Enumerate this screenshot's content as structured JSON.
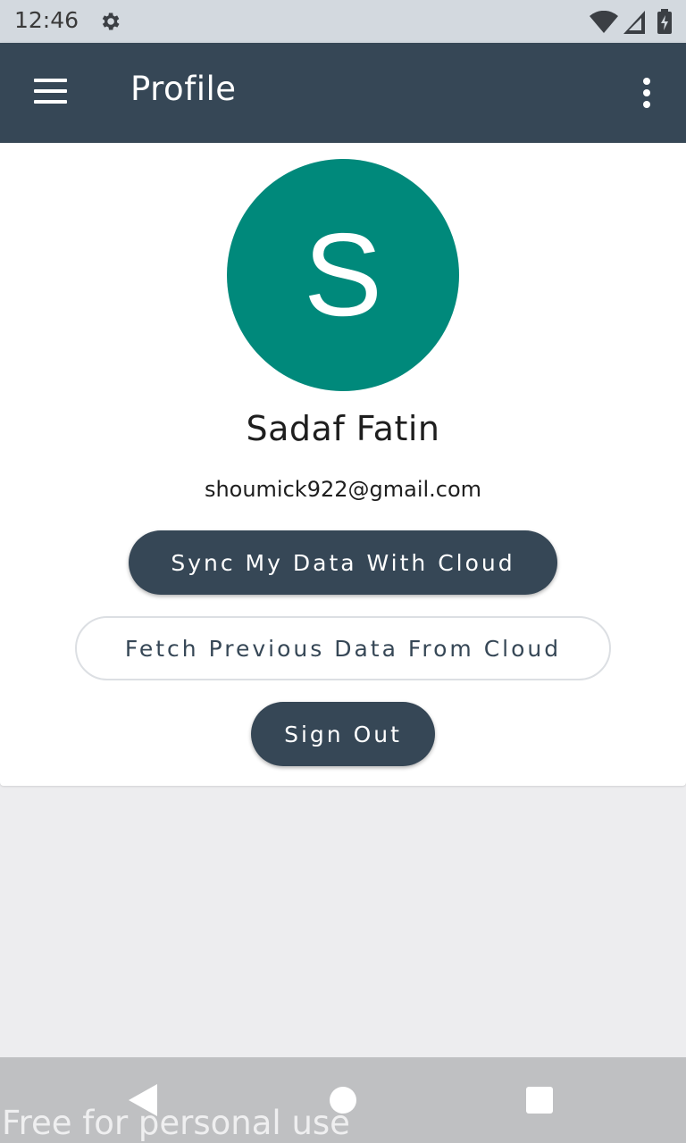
{
  "status_bar": {
    "time": "12:46",
    "icons": [
      "gear-icon",
      "wifi-icon",
      "signal-icon",
      "battery-charging-icon"
    ]
  },
  "app_bar": {
    "title": "Profile",
    "background_color": "#364756",
    "icons": [
      "hamburger-menu-icon",
      "more-vert-icon"
    ]
  },
  "profile": {
    "avatar_initial": "S",
    "avatar_color": "#00897b",
    "name": "Sadaf Fatin",
    "email": "shoumick922@gmail.com"
  },
  "actions": {
    "sync_label": "Sync My Data With Cloud",
    "fetch_label": "Fetch Previous Data From Cloud",
    "sign_out_label": "Sign Out"
  },
  "nav_bar": {
    "icons": [
      "back-icon",
      "home-icon",
      "recents-icon"
    ]
  },
  "watermark": "Free for personal use"
}
